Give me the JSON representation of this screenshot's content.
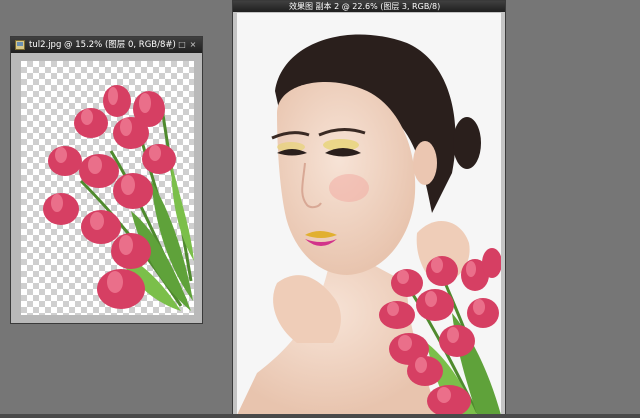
{
  "app": {
    "accent_color": "#767676",
    "titlebar_color": "#2a2a2a"
  },
  "left_window": {
    "title": "tul2.jpg @ 15.2% (图层 0, RGB/8#)",
    "icon": "photoshop-doc-icon",
    "controls": [
      "minimize-icon",
      "maximize-icon",
      "close-icon"
    ],
    "canvas": "transparent-checkerboard-with-tulip-bouquet"
  },
  "right_window": {
    "title": "效果图 副本 2 @ 22.6% (图层 3, RGB/8)",
    "canvas": "portrait-with-tulips"
  }
}
